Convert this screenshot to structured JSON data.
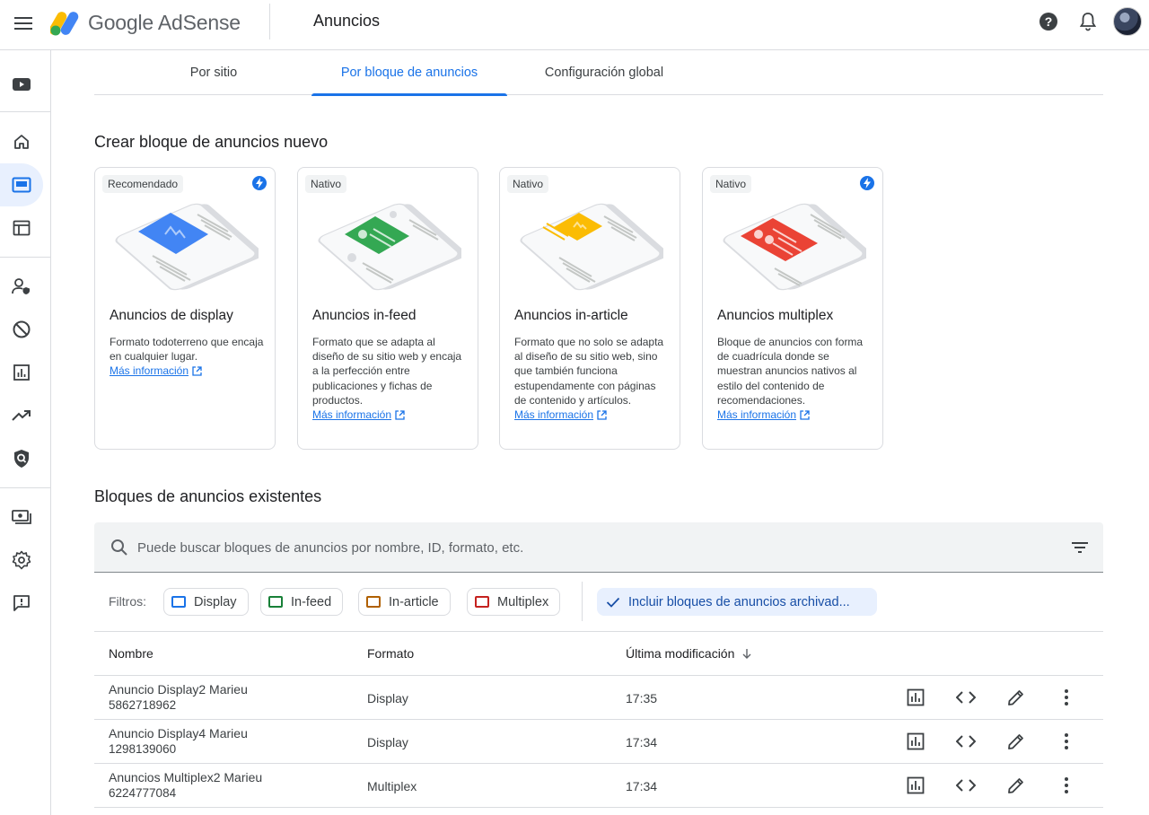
{
  "app": {
    "name": "Google AdSense",
    "page_title": "Anuncios"
  },
  "tabs": [
    {
      "label": "Por sitio",
      "active": false
    },
    {
      "label": "Por bloque de anuncios",
      "active": true
    },
    {
      "label": "Configuración global",
      "active": false
    }
  ],
  "create_section": {
    "title": "Crear bloque de anuncios nuevo",
    "cards": [
      {
        "chip": "Recomendado",
        "title": "Anuncios de display",
        "desc": "Formato todoterreno que encaja en cualquier lugar.",
        "link": "Más información",
        "accent": "#4285f4"
      },
      {
        "chip": "Nativo",
        "title": "Anuncios in-feed",
        "desc": "Formato que se adapta al diseño de su sitio web y encaja a la perfección entre publicaciones y fichas de productos.",
        "link": "Más información",
        "accent": "#34a853"
      },
      {
        "chip": "Nativo",
        "title": "Anuncios in-article",
        "desc": "Formato que no solo se adapta al diseño de su sitio web, sino que también funciona estupendamente con páginas de contenido y artículos.",
        "link": "Más información",
        "accent": "#fbbc04"
      },
      {
        "chip": "Nativo",
        "title": "Anuncios multiplex",
        "desc": "Bloque de anuncios con forma de cuadrícula donde se muestran anuncios nativos al estilo del contenido de recomendaciones.",
        "link": "Más información",
        "accent": "#ea4335"
      }
    ]
  },
  "existing_section": {
    "title": "Bloques de anuncios existentes",
    "search_placeholder": "Puede buscar bloques de anuncios por nombre, ID, formato, etc.",
    "filters_label": "Filtros:",
    "filters": [
      {
        "label": "Display",
        "color": "#1a73e8"
      },
      {
        "label": "In-feed",
        "color": "#188038"
      },
      {
        "label": "In-article",
        "color": "#b06000"
      },
      {
        "label": "Multiplex",
        "color": "#c5221f"
      }
    ],
    "archived_filter": "Incluir bloques de anuncios archivad..."
  },
  "table": {
    "columns": {
      "name": "Nombre",
      "format": "Formato",
      "modified": "Última modificación"
    },
    "rows": [
      {
        "name": "Anuncio Display2 Marieu",
        "id": "5862718962",
        "format": "Display",
        "modified": "17:35"
      },
      {
        "name": "Anuncio Display4 Marieu",
        "id": "1298139060",
        "format": "Display",
        "modified": "17:34"
      },
      {
        "name": "Anuncios Multiplex2 Marieu",
        "id": "6224777084",
        "format": "Multiplex",
        "modified": "17:34"
      }
    ]
  },
  "icons": {
    "rail": [
      "youtube-icon",
      "home-icon",
      "ads-icon",
      "layout-icon",
      "user-shield-icon",
      "block-icon",
      "bar-chart-icon",
      "trending-icon",
      "policy-icon",
      "payments-icon",
      "settings-icon",
      "feedback-icon"
    ],
    "row_actions": [
      "report-icon",
      "code-icon",
      "edit-icon",
      "more-icon"
    ]
  }
}
